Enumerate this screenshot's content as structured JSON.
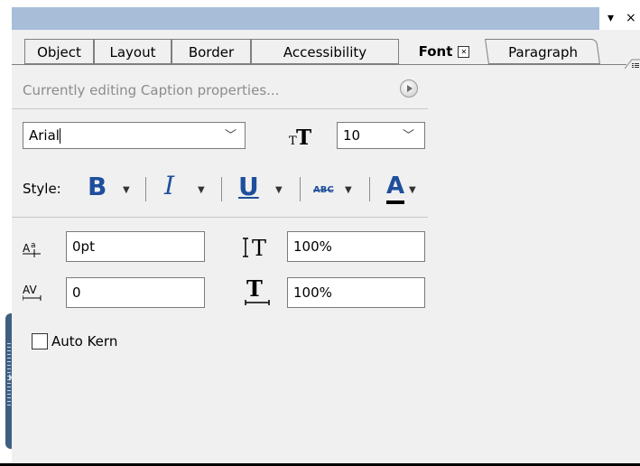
{
  "tabs": [
    "Object",
    "Layout",
    "Border",
    "Accessibility",
    "Font",
    "Paragraph"
  ],
  "status_text": "Currently editing Caption properties...",
  "font_family": "Arial",
  "font_size": "10",
  "style_label": "Style:",
  "spacing": {
    "baseline_shift": "0pt",
    "kerning": "0",
    "line_height": "100%",
    "scale": "100%"
  },
  "auto_kern_label": "Auto Kern",
  "icons": {
    "pin": "▾",
    "close": "×",
    "font_size": "T",
    "bold": "B",
    "italic": "I",
    "underline": "U",
    "strike": "ABC",
    "color": "A"
  },
  "colors": {
    "titlebar": "#a7bdd8",
    "accent_blue": "#1e4f9c",
    "panel_bg": "#f0f0f0"
  }
}
